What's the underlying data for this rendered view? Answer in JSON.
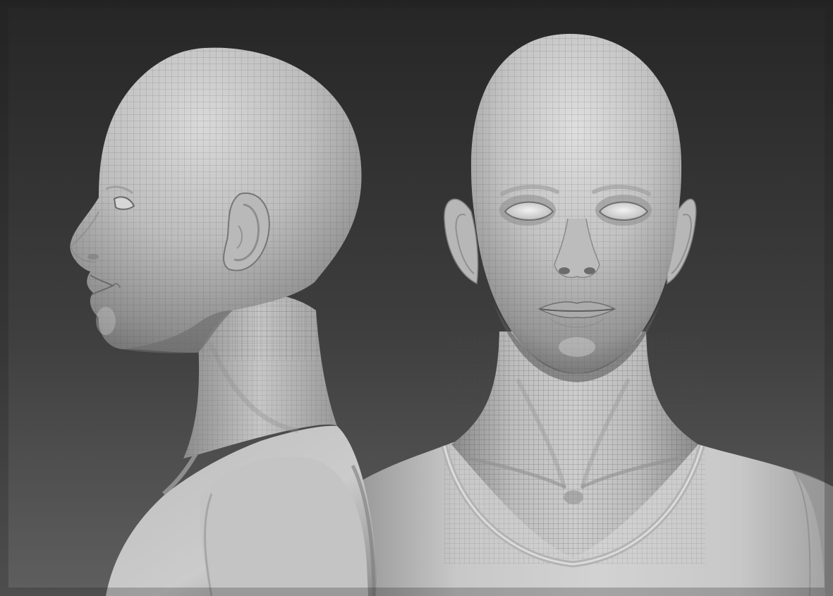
{
  "image": {
    "kind": "3d-sculpt-render",
    "views": [
      "profile-left",
      "front"
    ],
    "colors": {
      "background_top": "#272727",
      "background_bottom": "#5e5e5e",
      "clay_light": "#cfcfcf",
      "clay_mid": "#a7a7a7",
      "clay_dark": "#6b6b6b",
      "wireframe": "#5a5a5a"
    }
  }
}
